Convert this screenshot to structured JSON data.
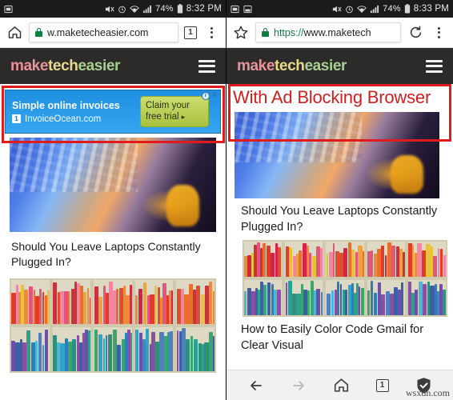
{
  "left_phone": {
    "statusbar": {
      "icons": [
        "sd-card-icon",
        "mute-icon",
        "alarm-icon",
        "wifi-icon",
        "signal-icon"
      ],
      "battery_pct": "74%",
      "time": "8:32 PM"
    },
    "chrome": {
      "home_icon": "home-icon",
      "url": "w.maketecheasier.com",
      "url_scheme": "",
      "tab_count": "1",
      "menu_icon": "kebab-menu-icon",
      "lock_icon": "lock-icon"
    },
    "site_header": {
      "logo_parts": [
        {
          "text": "make",
          "color": "#e8939b"
        },
        {
          "text": "tech",
          "color": "#e8d98a"
        },
        {
          "text": "easier",
          "color": "#a9cf92"
        }
      ],
      "menu_icon": "hamburger-menu-icon"
    },
    "ad": {
      "title": "Simple online invoices",
      "favicon_label": "1",
      "domain": "InvoiceOcean.com",
      "cta_line1": "Claim your",
      "cta_line2": "free trial",
      "cta_arrow": "▸",
      "adchoices_icon": "adchoices-info-icon",
      "close_label": "✕"
    },
    "articles": [
      {
        "title": "Should You Leave Laptops Constantly Plugged In?",
        "image": "laptop-keyboard-photo"
      },
      {
        "title": "",
        "image": "colorful-bookshelf-photo"
      }
    ]
  },
  "right_phone": {
    "statusbar": {
      "icons": [
        "sd-card-icon",
        "screenshot-icon",
        "mute-icon",
        "alarm-icon",
        "wifi-icon",
        "signal-icon"
      ],
      "battery_pct": "74%",
      "time": "8:33 PM"
    },
    "chrome": {
      "star_icon": "bookmark-star-icon",
      "url_scheme": "https://",
      "url": "www.maketech",
      "reload_icon": "reload-icon",
      "menu_icon": "kebab-menu-icon",
      "lock_icon": "lock-icon"
    },
    "site_header": {
      "logo_parts": [
        {
          "text": "make",
          "color": "#e8939b"
        },
        {
          "text": "tech",
          "color": "#e8d98a"
        },
        {
          "text": "easier",
          "color": "#a9cf92"
        }
      ],
      "menu_icon": "hamburger-menu-icon"
    },
    "annotation": {
      "headline": "With Ad Blocking Browser",
      "headline_color": "#cf1f1f"
    },
    "articles": [
      {
        "title": "Should You Leave Laptops Constantly Plugged In?",
        "image": "laptop-keyboard-photo"
      },
      {
        "title": "How to Easily Color Code Gmail for Clear Visual",
        "image": "colorful-bookshelf-photo"
      }
    ],
    "bottom_nav": {
      "back_icon": "back-arrow-icon",
      "forward_icon": "forward-arrow-icon",
      "home_icon": "home-icon",
      "tab_count": "1",
      "shield_icon": "adblock-shield-check-icon"
    }
  },
  "watermark": "wsxdn.com",
  "highlight_color": "#e01b1b"
}
